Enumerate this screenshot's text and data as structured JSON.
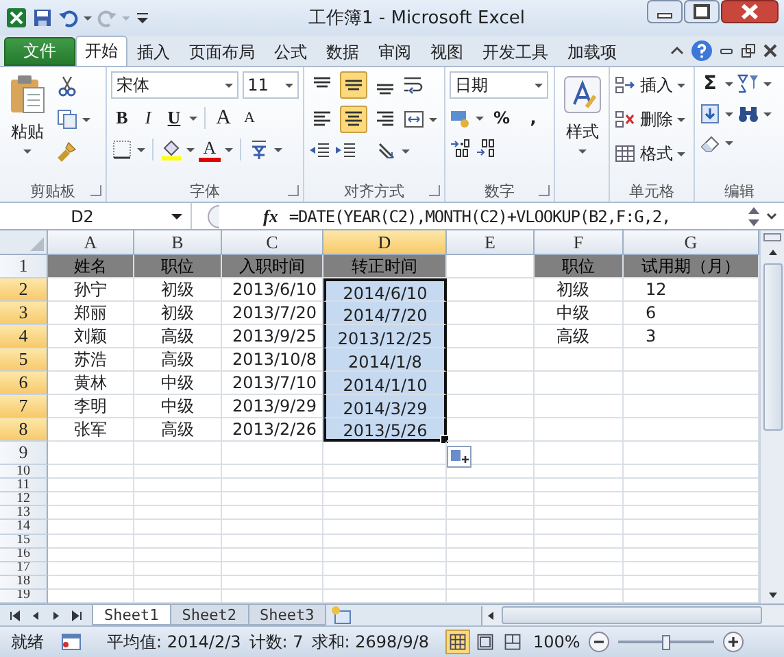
{
  "window": {
    "title": "工作簿1 - Microsoft Excel"
  },
  "ribbon_tabs": {
    "file": "文件",
    "tabs": [
      {
        "label": "开始",
        "selected": true
      },
      {
        "label": "插入",
        "selected": false
      },
      {
        "label": "页面布局",
        "selected": false
      },
      {
        "label": "公式",
        "selected": false
      },
      {
        "label": "数据",
        "selected": false
      },
      {
        "label": "审阅",
        "selected": false
      },
      {
        "label": "视图",
        "selected": false
      },
      {
        "label": "开发工具",
        "selected": false
      },
      {
        "label": "加载项",
        "selected": false
      }
    ]
  },
  "ribbon": {
    "clipboard": {
      "label": "剪贴板",
      "paste": "粘贴"
    },
    "font": {
      "label": "字体",
      "name": "宋体",
      "size": "11",
      "bold": "B",
      "italic": "I",
      "underline": "U",
      "grow": "A",
      "shrink": "A",
      "font_color": "A"
    },
    "alignment": {
      "label": "对齐方式",
      "vertical": [
        {
          "kind": "top",
          "selected": false
        },
        {
          "kind": "middle",
          "selected": true
        },
        {
          "kind": "bottom",
          "selected": false
        }
      ],
      "horizontal": [
        {
          "kind": "left",
          "selected": false
        },
        {
          "kind": "center",
          "selected": true
        },
        {
          "kind": "right",
          "selected": false
        }
      ]
    },
    "number": {
      "label": "数字",
      "format": "日期",
      "percent": "%",
      "comma": ","
    },
    "styles": {
      "button": "样式"
    },
    "cells": {
      "label": "单元格",
      "insert": "插入",
      "delete": "删除",
      "format": "格式"
    },
    "editing": {
      "label": "编辑",
      "sum": "Σ"
    }
  },
  "formula_bar": {
    "name_box": "D2",
    "fx": "fx",
    "formula": "=DATE(YEAR(C2),MONTH(C2)+VLOOKUP(B2,F:G,2,"
  },
  "sheet": {
    "columns": [
      {
        "label": "A",
        "selected": false
      },
      {
        "label": "B",
        "selected": false
      },
      {
        "label": "C",
        "selected": false
      },
      {
        "label": "D",
        "selected": true
      },
      {
        "label": "E",
        "selected": false
      },
      {
        "label": "F",
        "selected": false
      },
      {
        "label": "G",
        "selected": false
      }
    ],
    "rows": [
      {
        "num": "1",
        "selected": false,
        "cells": [
          {
            "text": "姓名",
            "kind": "header",
            "selected": false
          },
          {
            "text": "职位",
            "kind": "header",
            "selected": false
          },
          {
            "text": "入职时间",
            "kind": "header",
            "selected": false
          },
          {
            "text": "转正时间",
            "kind": "header",
            "selected": false
          },
          null,
          {
            "text": "职位",
            "kind": "header",
            "selected": false
          },
          {
            "text": "试用期（月）",
            "kind": "header",
            "selected": false
          }
        ]
      },
      {
        "num": "2",
        "selected": true,
        "cells": [
          {
            "text": "孙宁",
            "kind": "value",
            "selected": false
          },
          {
            "text": "初级",
            "kind": "value",
            "selected": false
          },
          {
            "text": "2013/6/10",
            "kind": "value",
            "selected": false
          },
          {
            "text": "2014/6/10",
            "kind": "value",
            "selected": true
          },
          null,
          {
            "text": "初级",
            "kind": "value",
            "selected": false
          },
          {
            "text": "12",
            "kind": "value",
            "selected": false
          }
        ]
      },
      {
        "num": "3",
        "selected": true,
        "cells": [
          {
            "text": "郑丽",
            "kind": "value",
            "selected": false
          },
          {
            "text": "初级",
            "kind": "value",
            "selected": false
          },
          {
            "text": "2013/7/20",
            "kind": "value",
            "selected": false
          },
          {
            "text": "2014/7/20",
            "kind": "value",
            "selected": true
          },
          null,
          {
            "text": "中级",
            "kind": "value",
            "selected": false
          },
          {
            "text": "6",
            "kind": "value",
            "selected": false
          }
        ]
      },
      {
        "num": "4",
        "selected": true,
        "cells": [
          {
            "text": "刘颖",
            "kind": "value",
            "selected": false
          },
          {
            "text": "高级",
            "kind": "value",
            "selected": false
          },
          {
            "text": "2013/9/25",
            "kind": "value",
            "selected": false
          },
          {
            "text": "2013/12/25",
            "kind": "value",
            "selected": true
          },
          null,
          {
            "text": "高级",
            "kind": "value",
            "selected": false
          },
          {
            "text": "3",
            "kind": "value",
            "selected": false
          }
        ]
      },
      {
        "num": "5",
        "selected": true,
        "cells": [
          {
            "text": "苏浩",
            "kind": "value",
            "selected": false
          },
          {
            "text": "高级",
            "kind": "value",
            "selected": false
          },
          {
            "text": "2013/10/8",
            "kind": "value",
            "selected": false
          },
          {
            "text": "2014/1/8",
            "kind": "value",
            "selected": true
          },
          null,
          null,
          null
        ]
      },
      {
        "num": "6",
        "selected": true,
        "cells": [
          {
            "text": "黄林",
            "kind": "value",
            "selected": false
          },
          {
            "text": "中级",
            "kind": "value",
            "selected": false
          },
          {
            "text": "2013/7/10",
            "kind": "value",
            "selected": false
          },
          {
            "text": "2014/1/10",
            "kind": "value",
            "selected": true
          },
          null,
          null,
          null
        ]
      },
      {
        "num": "7",
        "selected": true,
        "cells": [
          {
            "text": "李明",
            "kind": "value",
            "selected": false
          },
          {
            "text": "中级",
            "kind": "value",
            "selected": false
          },
          {
            "text": "2013/9/29",
            "kind": "value",
            "selected": false
          },
          {
            "text": "2014/3/29",
            "kind": "value",
            "selected": true
          },
          null,
          null,
          null
        ]
      },
      {
        "num": "8",
        "selected": true,
        "cells": [
          {
            "text": "张军",
            "kind": "value",
            "selected": false
          },
          {
            "text": "高级",
            "kind": "value",
            "selected": false
          },
          {
            "text": "2013/2/26",
            "kind": "value",
            "selected": false
          },
          {
            "text": "2013/5/26",
            "kind": "value",
            "selected": true
          },
          null,
          null,
          null
        ]
      },
      {
        "num": "9",
        "selected": false,
        "cells": []
      },
      {
        "num": "10",
        "selected": false,
        "cells": []
      },
      {
        "num": "11",
        "selected": false,
        "cells": []
      },
      {
        "num": "12",
        "selected": false,
        "cells": []
      },
      {
        "num": "13",
        "selected": false,
        "cells": []
      },
      {
        "num": "14",
        "selected": false,
        "cells": []
      },
      {
        "num": "15",
        "selected": false,
        "cells": []
      },
      {
        "num": "16",
        "selected": false,
        "cells": []
      },
      {
        "num": "17",
        "selected": false,
        "cells": []
      },
      {
        "num": "18",
        "selected": false,
        "cells": []
      },
      {
        "num": "19",
        "selected": false,
        "cells": []
      }
    ]
  },
  "sheet_tabs": [
    {
      "label": "Sheet1",
      "selected": true
    },
    {
      "label": "Sheet2",
      "selected": false
    },
    {
      "label": "Sheet3",
      "selected": false
    }
  ],
  "status_bar": {
    "ready": "就绪",
    "average": "平均值: 2014/2/3",
    "count": "计数: 7",
    "sum": "求和: 2698/9/8",
    "views": [
      {
        "kind": "normal",
        "selected": true
      },
      {
        "kind": "page_layout",
        "selected": false
      },
      {
        "kind": "page_break",
        "selected": false
      }
    ],
    "zoom": "100%",
    "zoom_slider": {
      "level": 0.5
    }
  }
}
